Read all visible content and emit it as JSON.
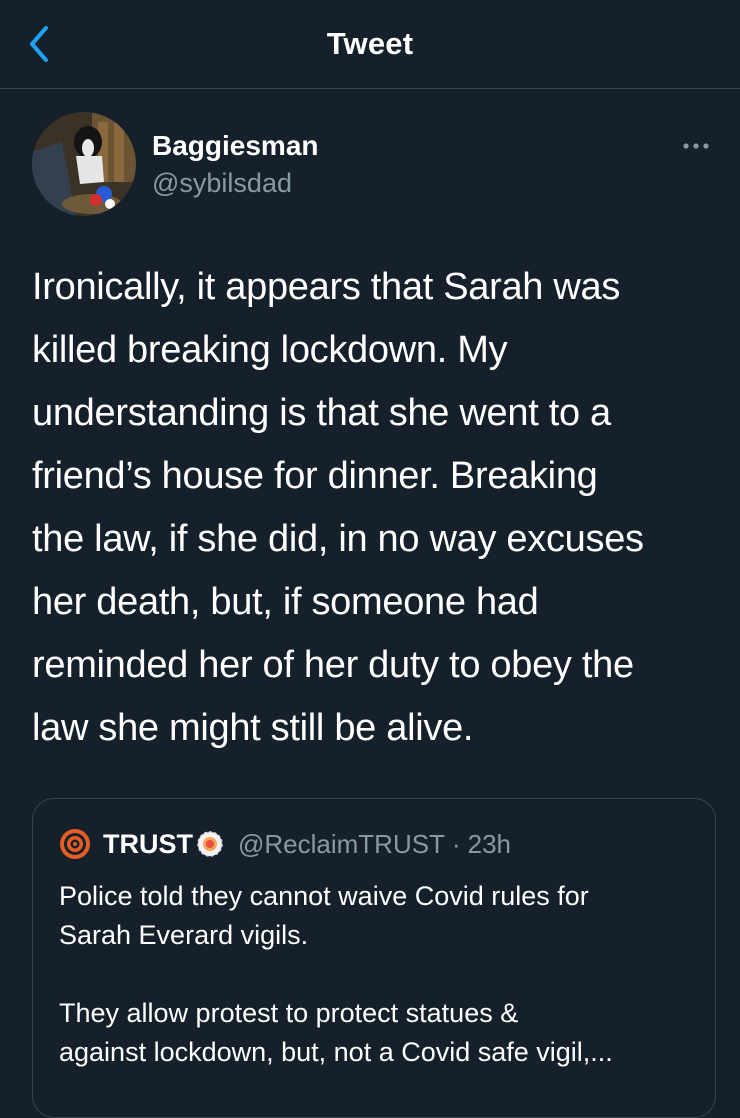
{
  "header": {
    "title": "Tweet",
    "back_icon": "chevron-left-icon"
  },
  "colors": {
    "background": "#15202b",
    "accent": "#1da1f2",
    "secondary_text": "#8899a6",
    "divider": "#38444d"
  },
  "tweet": {
    "author": {
      "display_name": "Baggiesman",
      "handle": "@sybilsdad"
    },
    "more_icon": "more-horizontal-icon",
    "text": "Ironically, it appears that Sarah was\nkilled breaking lockdown. My\nunderstanding is that she went to a\nfriend’s house for dinner. Breaking\nthe law, if she did, in no way excuses\nher death, but, if someone had\nreminded her of her duty to obey the\nlaw she might still be alive."
  },
  "quoted_tweet": {
    "author": {
      "display_name": "TRUST",
      "handle": "@ReclaimTRUST",
      "badge_icon": "emoji-badge-icon"
    },
    "separator": "·",
    "time": "23h",
    "text": "Police told they cannot waive Covid rules for\nSarah Everard vigils.\n\nThey allow protest to protect statues &\nagainst lockdown, but, not a Covid safe vigil,..."
  }
}
